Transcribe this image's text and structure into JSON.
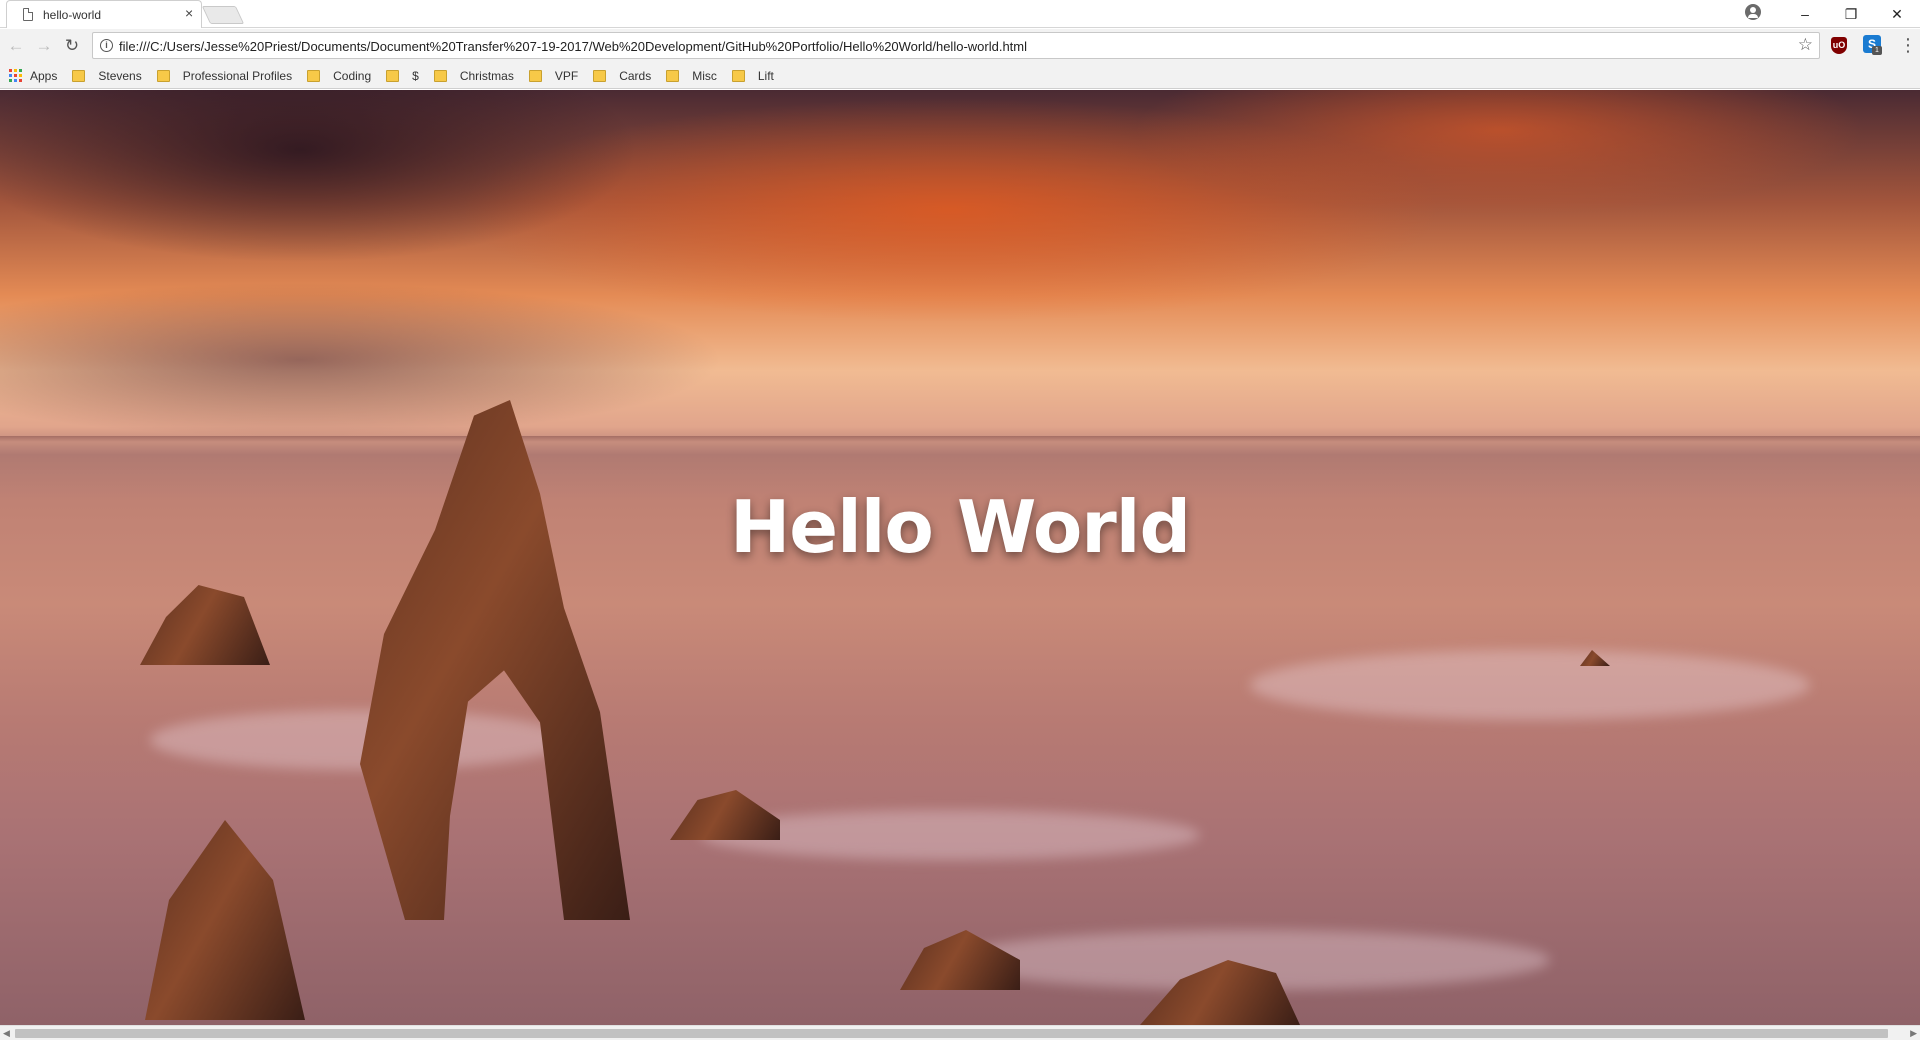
{
  "browser": {
    "tab": {
      "title": "hello-world",
      "close_glyph": "×"
    },
    "window_controls": {
      "minimize": "–",
      "restore": "❐",
      "close": "✕"
    },
    "address_bar": {
      "url": "file:///C:/Users/Jesse%20Priest/Documents/Document%20Transfer%207-19-2017/Web%20Development/GitHub%20Portfolio/Hello%20World/hello-world.html"
    },
    "extensions": {
      "ublock_label": "uO",
      "skype_label": "S",
      "skype_badge": "1"
    },
    "bookmarks": [
      {
        "label": "Apps",
        "icon": "apps-grid-icon"
      },
      {
        "label": "Stevens",
        "icon": "folder-icon"
      },
      {
        "label": "Professional Profiles",
        "icon": "folder-icon"
      },
      {
        "label": "Coding",
        "icon": "folder-icon"
      },
      {
        "label": "$",
        "icon": "folder-icon"
      },
      {
        "label": "Christmas",
        "icon": "folder-icon"
      },
      {
        "label": "VPF",
        "icon": "folder-icon"
      },
      {
        "label": "Cards",
        "icon": "folder-icon"
      },
      {
        "label": "Misc",
        "icon": "folder-icon"
      },
      {
        "label": "Lift",
        "icon": "folder-icon"
      }
    ]
  },
  "page": {
    "heading": "Hello World",
    "background": "sunset-seascape-with-sea-arch"
  },
  "colors": {
    "folder": "#f7c948",
    "ublock": "#800000",
    "skype": "#1a7bd1"
  }
}
